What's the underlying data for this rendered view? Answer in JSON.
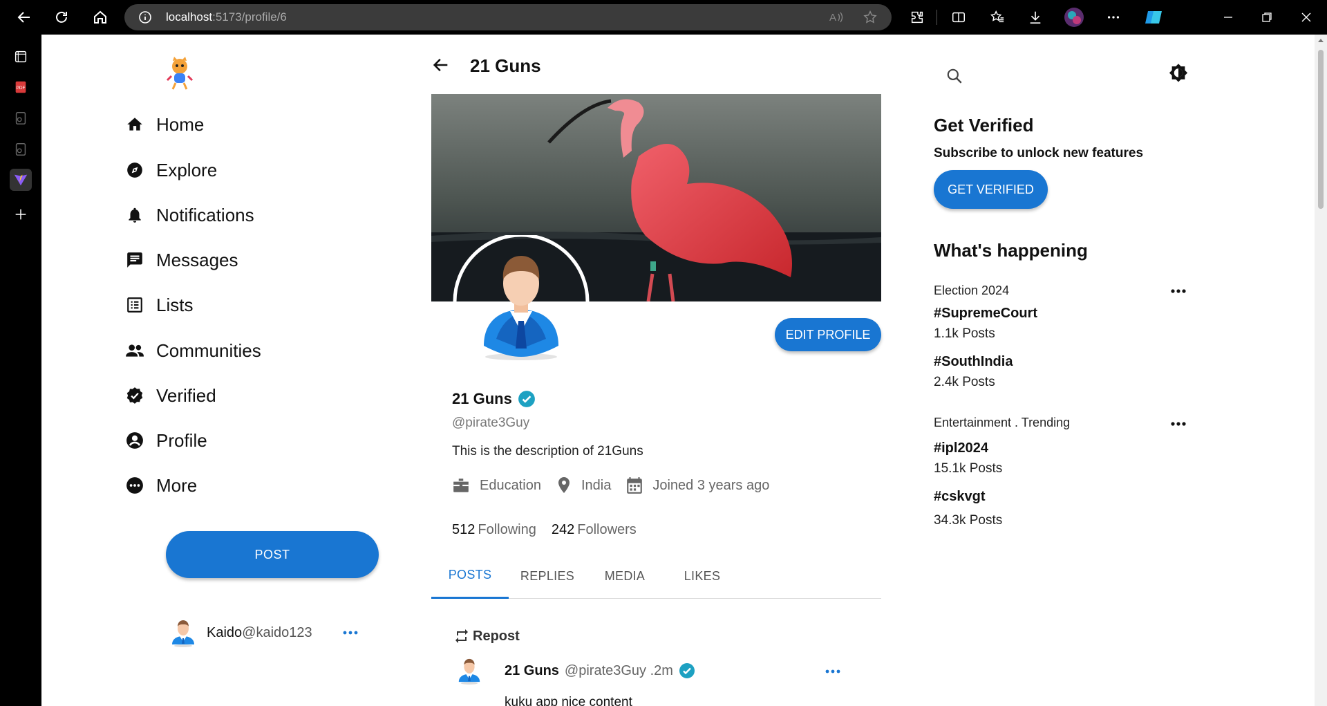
{
  "browser": {
    "url_host": "localhost",
    "url_path": ":5173/profile/6"
  },
  "colors": {
    "accent": "#1976d2",
    "verified": "#1da1c2"
  },
  "sidebar": {
    "logo": "cat-mascot-logo",
    "items": [
      {
        "label": "Home",
        "icon": "home-icon"
      },
      {
        "label": "Explore",
        "icon": "compass-icon"
      },
      {
        "label": "Notifications",
        "icon": "bell-icon"
      },
      {
        "label": "Messages",
        "icon": "message-icon"
      },
      {
        "label": "Lists",
        "icon": "list-icon"
      },
      {
        "label": "Communities",
        "icon": "people-icon"
      },
      {
        "label": "Verified",
        "icon": "verified-badge-icon"
      },
      {
        "label": "Profile",
        "icon": "account-circle-icon"
      },
      {
        "label": "More",
        "icon": "more-circle-icon"
      }
    ],
    "post_label": "POST",
    "user": {
      "name": "Kaido",
      "handle": "@kaido123"
    }
  },
  "profile": {
    "header_title": "21 Guns",
    "edit_label": "EDIT PROFILE",
    "name": "21 Guns",
    "handle": "@pirate3Guy",
    "description": "This is the description of 21Guns",
    "category": "Education",
    "location": "India",
    "joined": "Joined 3 years ago",
    "following_count": "512",
    "following_label": "Following",
    "followers_count": "242",
    "followers_label": "Followers",
    "tabs": [
      "POSTS",
      "REPLIES",
      "MEDIA",
      "LIKES"
    ],
    "active_tab": "POSTS"
  },
  "feed": {
    "repost_label": "Repost",
    "post": {
      "author": "21 Guns",
      "handle_time": "@pirate3Guy .2m",
      "text": "kuku app nice content"
    }
  },
  "right": {
    "get_verified_title": "Get Verified",
    "get_verified_sub": "Subscribe to unlock new features",
    "get_verified_btn": "GET VERIFIED",
    "happening_title": "What's happening",
    "trends": [
      {
        "category": "Election 2024",
        "tag": "#SupremeCourt",
        "count": "1.1k Posts"
      },
      {
        "category": "",
        "tag": "#SouthIndia",
        "count": "2.4k Posts"
      },
      {
        "category": "Entertainment . Trending",
        "tag": "#ipl2024",
        "count": "15.1k Posts"
      },
      {
        "category": "",
        "tag": "#cskvgt",
        "count": "34.3k Posts"
      }
    ]
  }
}
